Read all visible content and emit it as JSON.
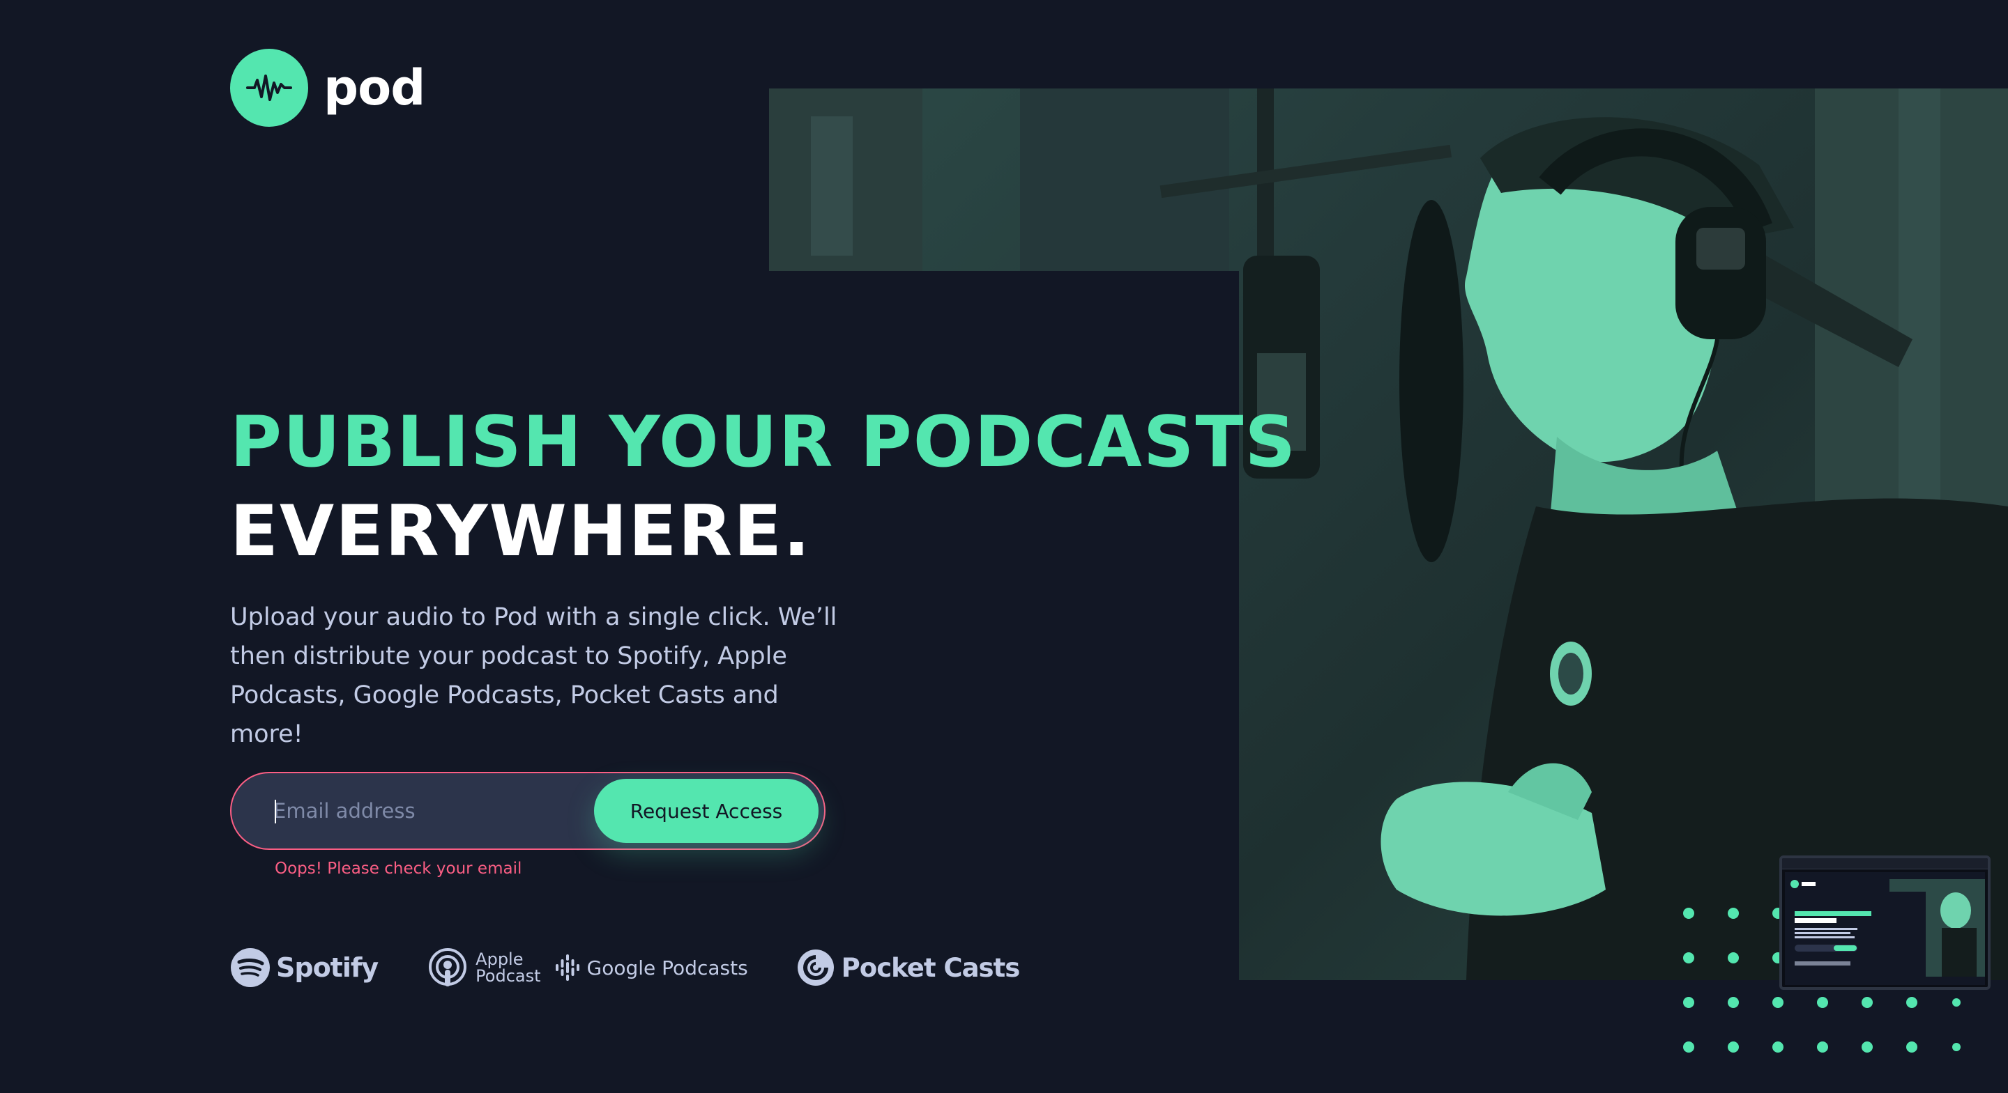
{
  "brand": {
    "name": "pod",
    "logo_icon": "waveform-icon"
  },
  "hero": {
    "headline_accent": "PUBLISH YOUR PODCASTS",
    "headline_plain": "EVERYWHERE.",
    "description": "Upload your audio to Pod with a single click. We’ll then distribute your podcast to Spotify, Apple Podcasts, Google Podcasts, Pocket Casts and more!",
    "image_subject": "person-with-headphones-at-microphone"
  },
  "form": {
    "email_placeholder": "Email address",
    "email_value": "",
    "submit_label": "Request Access",
    "error_message": "Oops! Please check your email"
  },
  "partners": [
    {
      "name": "Spotify",
      "icon": "spotify-icon"
    },
    {
      "name": "Apple",
      "name2": "Podcast",
      "icon": "apple-podcast-icon"
    },
    {
      "name": "Google Podcasts",
      "icon": "google-podcasts-icon"
    },
    {
      "name": "Pocket Casts",
      "icon": "pocket-casts-icon"
    }
  ],
  "colors": {
    "background": "#121725",
    "accent": "#54E6AF",
    "text_light": "#C2CBE5",
    "error": "#FB5E84",
    "input_bg": "#2C344B"
  }
}
